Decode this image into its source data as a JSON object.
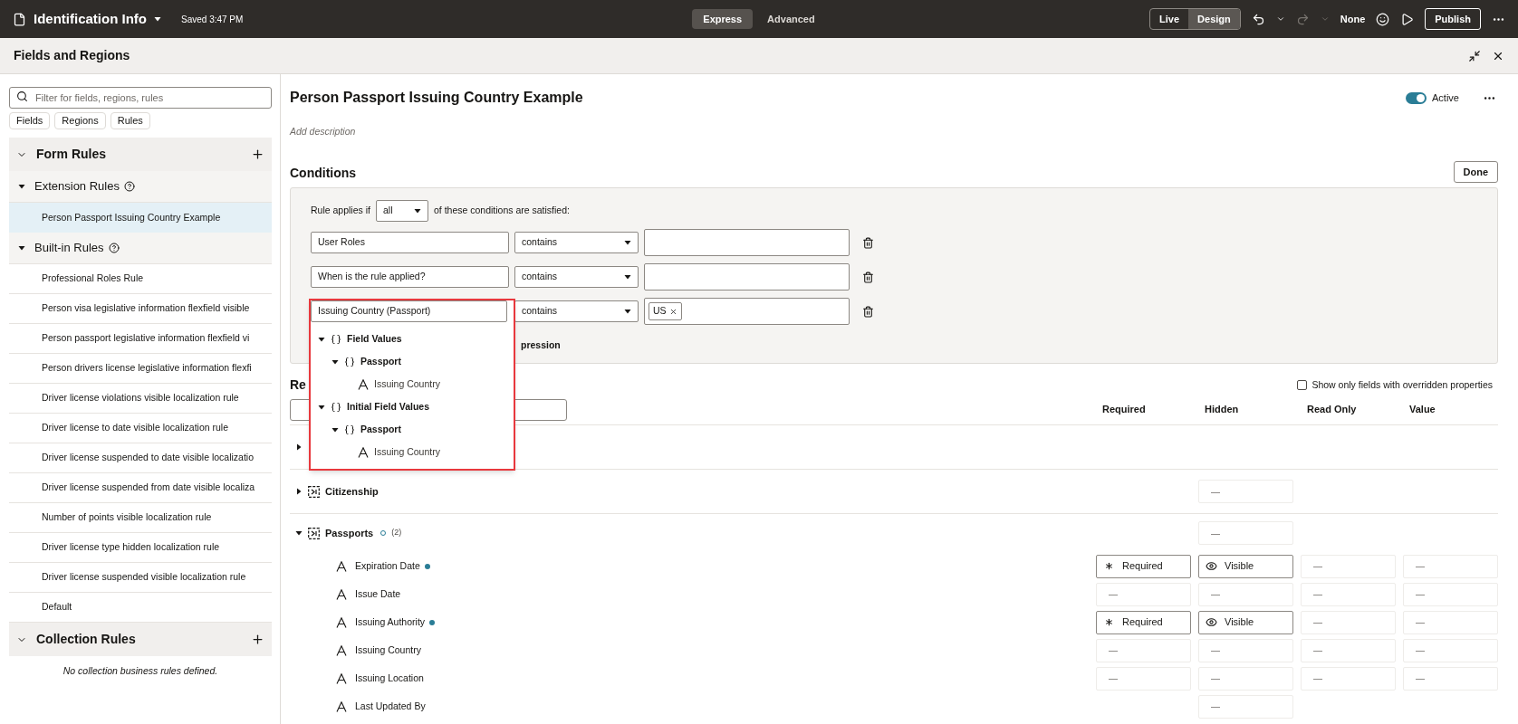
{
  "header": {
    "title": "Identification Info",
    "saved": "Saved 3:47 PM",
    "modes": [
      {
        "label": "Express",
        "selected": true
      },
      {
        "label": "Advanced",
        "selected": false
      }
    ],
    "views": [
      {
        "label": "Live",
        "selected": false
      },
      {
        "label": "Design",
        "selected": true
      }
    ],
    "redo_disabled": true,
    "layout_label": "None",
    "publish": "Publish"
  },
  "panel": {
    "title": "Fields and Regions"
  },
  "sidebar": {
    "search": {
      "placeholder": "Filter for fields, regions, rules"
    },
    "filters": [
      "Fields",
      "Regions",
      "Rules"
    ],
    "sections": [
      {
        "title": "Form Rules",
        "expanded": true,
        "groups": [
          {
            "title": "Extension Rules",
            "expanded": true,
            "rules": [
              {
                "label": "Person Passport Issuing Country Example",
                "selected": true
              }
            ]
          },
          {
            "title": "Built-in Rules",
            "expanded": true,
            "rules": [
              {
                "label": "Professional Roles Rule",
                "selected": false
              },
              {
                "label": "Person visa legislative information flexfield visible",
                "selected": false
              },
              {
                "label": "Person passport legislative information flexfield vi",
                "selected": false
              },
              {
                "label": "Person drivers license legislative information flexfi",
                "selected": false
              },
              {
                "label": "Driver license violations visible localization rule",
                "selected": false
              },
              {
                "label": "Driver license to date visible localization rule",
                "selected": false
              },
              {
                "label": "Driver license suspended to date visible localizatio",
                "selected": false
              },
              {
                "label": "Driver license suspended from date visible localiza",
                "selected": false
              },
              {
                "label": "Number of points visible localization rule",
                "selected": false
              },
              {
                "label": "Driver license type hidden localization rule",
                "selected": false
              },
              {
                "label": "Driver license suspended visible localization rule",
                "selected": false
              },
              {
                "label": "Default",
                "selected": false
              }
            ]
          }
        ]
      },
      {
        "title": "Collection Rules",
        "expanded": true,
        "empty_message": "No collection business rules defined."
      }
    ]
  },
  "rule": {
    "title": "Person Passport Issuing Country Example",
    "description_placeholder": "Add description",
    "status": {
      "label": "Active",
      "on": true
    }
  },
  "conditions": {
    "title": "Conditions",
    "done": "Done",
    "match_prefix": "Rule applies if",
    "match_value": "all",
    "match_suffix": "of these conditions are satisfied:",
    "rows": [
      {
        "field": "User Roles",
        "operator": "contains",
        "highlighted": false
      },
      {
        "field": "When is the rule applied?",
        "operator": "contains",
        "highlighted": false
      },
      {
        "field": "Issuing Country (Passport)",
        "operator": "contains",
        "tags": [
          "US"
        ],
        "highlighted": true
      }
    ],
    "picker": [
      {
        "label": "Field Values",
        "kind": "object",
        "expanded": true,
        "children": [
          {
            "label": "Passport",
            "kind": "object",
            "expanded": true,
            "children": [
              {
                "label": "Issuing Country",
                "kind": "field"
              }
            ]
          }
        ]
      },
      {
        "label": "Initial Field Values",
        "kind": "object",
        "expanded": true,
        "children": [
          {
            "label": "Passport",
            "kind": "object",
            "expanded": true,
            "children": [
              {
                "label": "Issuing Country",
                "kind": "field"
              }
            ]
          }
        ]
      }
    ],
    "expression_link": "pression"
  },
  "regions": {
    "heading": "Re",
    "filter_checkbox": {
      "label": "Show only fields with overridden properties",
      "checked": false
    },
    "columns": [
      "Required",
      "Hidden",
      "Read Only",
      "Value"
    ],
    "rows": [
      {
        "expanded": false
      },
      {
        "label": "Citizenship",
        "expanded": false,
        "cells": {
          "hidden": {
            "text": "—",
            "set": false
          }
        }
      },
      {
        "label": "Passports",
        "expanded": true,
        "count": "(2)",
        "cells": {
          "hidden": {
            "text": "—",
            "set": false
          }
        },
        "children": [
          {
            "label": "Expiration Date",
            "modified": true,
            "cells": {
              "required": {
                "text": "Required",
                "set": true
              },
              "hidden": {
                "text": "Visible",
                "set": true
              },
              "read_only": {
                "text": "—",
                "set": false
              },
              "value": {
                "text": "—",
                "set": false
              }
            }
          },
          {
            "label": "Issue Date",
            "modified": false,
            "cells": {
              "required": {
                "text": "—",
                "set": false
              },
              "hidden": {
                "text": "—",
                "set": false
              },
              "read_only": {
                "text": "—",
                "set": false
              },
              "value": {
                "text": "—",
                "set": false
              }
            }
          },
          {
            "label": "Issuing Authority",
            "modified": true,
            "cells": {
              "required": {
                "text": "Required",
                "set": true
              },
              "hidden": {
                "text": "Visible",
                "set": true
              },
              "read_only": {
                "text": "—",
                "set": false
              },
              "value": {
                "text": "—",
                "set": false
              }
            }
          },
          {
            "label": "Issuing Country",
            "modified": false,
            "cells": {
              "required": {
                "text": "—",
                "set": false
              },
              "hidden": {
                "text": "—",
                "set": false
              },
              "read_only": {
                "text": "—",
                "set": false
              },
              "value": {
                "text": "—",
                "set": false
              }
            }
          },
          {
            "label": "Issuing Location",
            "modified": false,
            "cells": {
              "required": {
                "text": "—",
                "set": false
              },
              "hidden": {
                "text": "—",
                "set": false
              },
              "read_only": {
                "text": "—",
                "set": false
              },
              "value": {
                "text": "—",
                "set": false
              }
            }
          },
          {
            "label": "Last Updated By",
            "modified": false,
            "cells": {
              "hidden": {
                "text": "—",
                "set": false
              }
            }
          }
        ]
      }
    ]
  }
}
